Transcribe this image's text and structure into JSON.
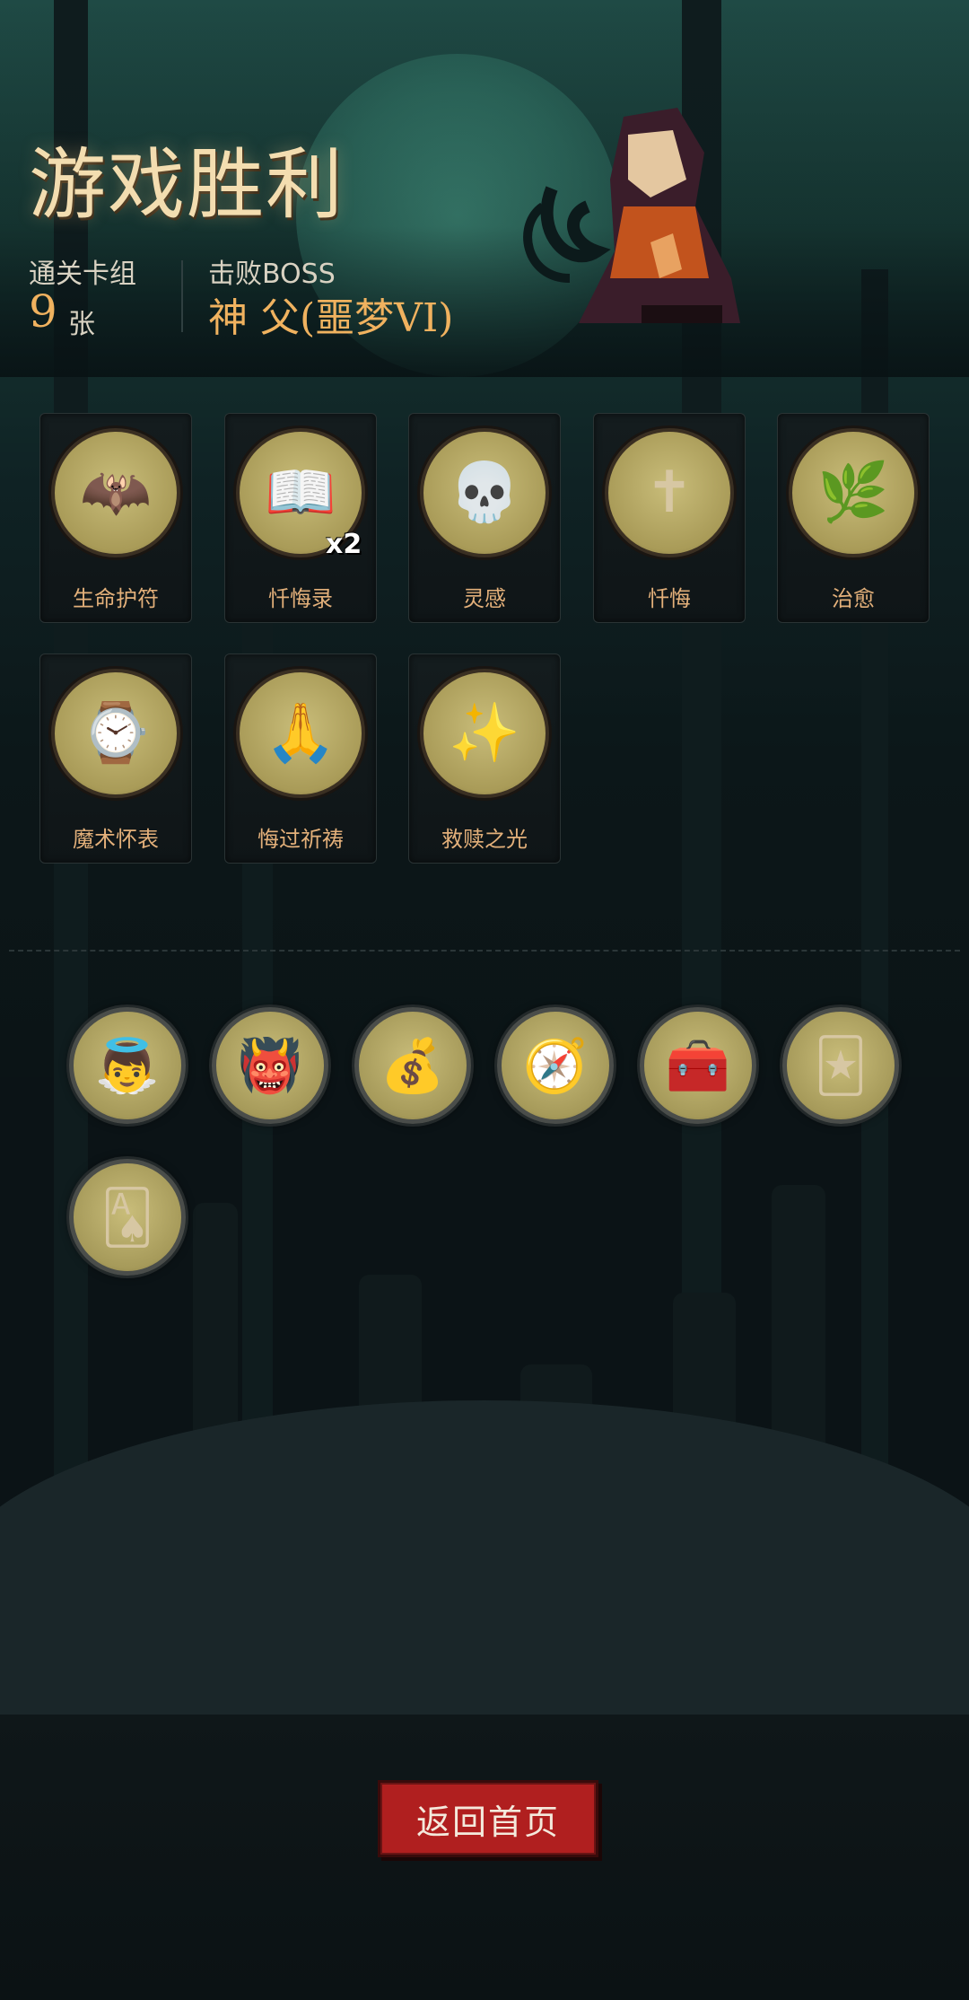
{
  "header": {
    "title": "游戏胜利",
    "deck_label": "通关卡组",
    "deck_count": "9",
    "deck_unit": "张",
    "boss_label": "击败BOSS",
    "boss_name": "神 父(噩梦VI)"
  },
  "cards": [
    {
      "name": "生命护符",
      "icon": "bat-icon",
      "glyph": "🦇",
      "count": ""
    },
    {
      "name": "忏悔录",
      "icon": "book-icon",
      "glyph": "📖",
      "count": "x2"
    },
    {
      "name": "灵感",
      "icon": "skull-brain-icon",
      "glyph": "💀",
      "count": ""
    },
    {
      "name": "忏悔",
      "icon": "cross-icon",
      "glyph": "✝",
      "count": ""
    },
    {
      "name": "治愈",
      "icon": "healing-plant-icon",
      "glyph": "🌿",
      "count": ""
    },
    {
      "name": "魔术怀表",
      "icon": "pocket-watch-icon",
      "glyph": "⌚",
      "count": ""
    },
    {
      "name": "悔过祈祷",
      "icon": "praying-monk-icon",
      "glyph": "🙏",
      "count": ""
    },
    {
      "name": "救赎之光",
      "icon": "light-beam-icon",
      "glyph": "✨",
      "count": ""
    }
  ],
  "relics": [
    {
      "icon": "angel-scroll-icon",
      "glyph": "👼"
    },
    {
      "icon": "red-demon-icon",
      "glyph": "👹"
    },
    {
      "icon": "treasure-gold-icon",
      "glyph": "💰"
    },
    {
      "icon": "ice-compass-icon",
      "glyph": "🧭"
    },
    {
      "icon": "treasure-chest-icon",
      "glyph": "🧰"
    },
    {
      "icon": "card-hand-icon",
      "glyph": "🃏"
    },
    {
      "icon": "playing-cards-icon",
      "glyph": "🂡"
    }
  ],
  "button": {
    "label": "返回首页"
  },
  "colors": {
    "accent": "#f0b25f",
    "button": "#b01f1f",
    "title": "#f3ddb0"
  }
}
